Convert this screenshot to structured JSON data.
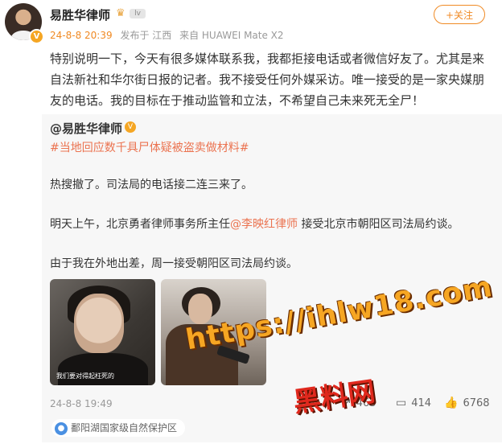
{
  "author": {
    "name": "易胜华律师",
    "level": "lv"
  },
  "meta": {
    "time": "24-8-8 20:39",
    "published_in": "发布于 江西",
    "via": "来自 HUAWEI Mate X2"
  },
  "follow_button": "+关注",
  "post_text": "特别说明一下，今天有很多媒体联系我，我都拒接电话或者微信好友了。尤其是来自法新社和华尔街日报的记者。我不接受任何外媒采访。唯一接受的是一家央媒朋友的电话。我的目标在于推动监管和立法，不希望自己未来死无全尸！",
  "repost": {
    "author": "@易胜华律师",
    "topic": "#当地回应数千具尸体疑被盗卖做材料#",
    "line1": "热搜撤了。司法局的电话接二连三来了。",
    "line2_pre": "明天上午，北京勇者律师事务所主任",
    "line2_mention": "@李映红律师",
    "line2_post": " 接受北京市朝阳区司法局约谈。",
    "line3": "由于我在外地出差，周一接受朝阳区司法局约谈。",
    "image1_caption": "我们要对得起枉死的",
    "time": "24-8-8 19:49",
    "shares": "463",
    "comments": "414",
    "likes": "6768",
    "location": "鄱阳湖国家级自然保护区"
  },
  "watermark": {
    "url": "https://ihlw18.com",
    "name": "黑料网"
  },
  "icons": {
    "verified": "verified-icon",
    "crown": "crown-icon",
    "share": "share-icon",
    "comment": "comment-icon",
    "like": "like-icon",
    "location": "location-pin-icon"
  },
  "colors": {
    "accent": "#f08a24",
    "link": "#eb7350",
    "watermark": "#f6a623"
  }
}
